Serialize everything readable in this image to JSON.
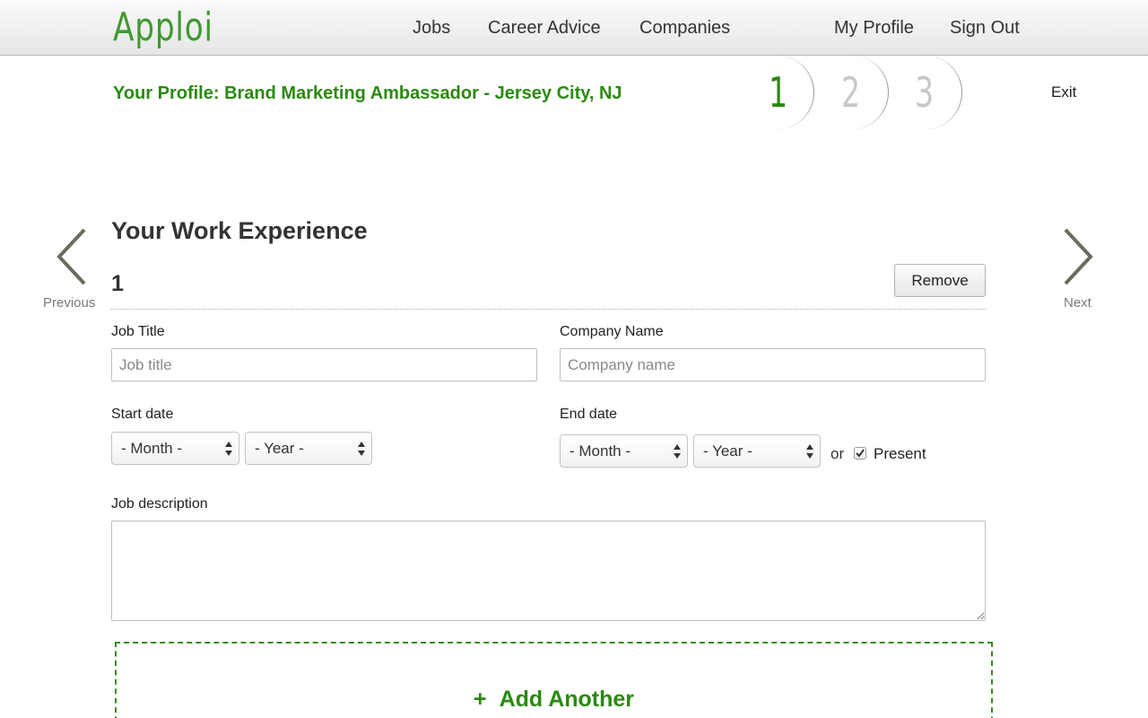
{
  "header": {
    "logo": "Apploi",
    "nav": {
      "jobs": "Jobs",
      "career_advice": "Career Advice",
      "companies": "Companies",
      "my_profile": "My Profile",
      "sign_out": "Sign Out"
    }
  },
  "profile": {
    "title": "Your Profile: Brand Marketing Ambassador - Jersey City, NJ",
    "steps": [
      {
        "label": "1",
        "active": true
      },
      {
        "label": "2",
        "active": false
      },
      {
        "label": "3",
        "active": false
      }
    ],
    "exit_label": "Exit"
  },
  "side_nav": {
    "previous_label": "Previous",
    "next_label": "Next"
  },
  "section": {
    "title": "Your Work Experience",
    "entry_number": "1",
    "remove_label": "Remove",
    "job_title": {
      "label": "Job Title",
      "placeholder": "Job title",
      "value": ""
    },
    "company_name": {
      "label": "Company Name",
      "placeholder": "Company name",
      "value": ""
    },
    "start_date": {
      "label": "Start date",
      "month": "- Month -",
      "year": "- Year -"
    },
    "end_date": {
      "label": "End date",
      "month": "- Month -",
      "year": "- Year -"
    },
    "or_text": "or",
    "present": {
      "label": "Present",
      "checked": true
    },
    "job_description": {
      "label": "Job description",
      "value": ""
    },
    "add_another": {
      "plus": "+",
      "label": "Add Another"
    }
  },
  "colors": {
    "brand_green": "#2a8a10",
    "logo_green": "#3e9a2e",
    "inactive_step": "#c8c8c8"
  }
}
